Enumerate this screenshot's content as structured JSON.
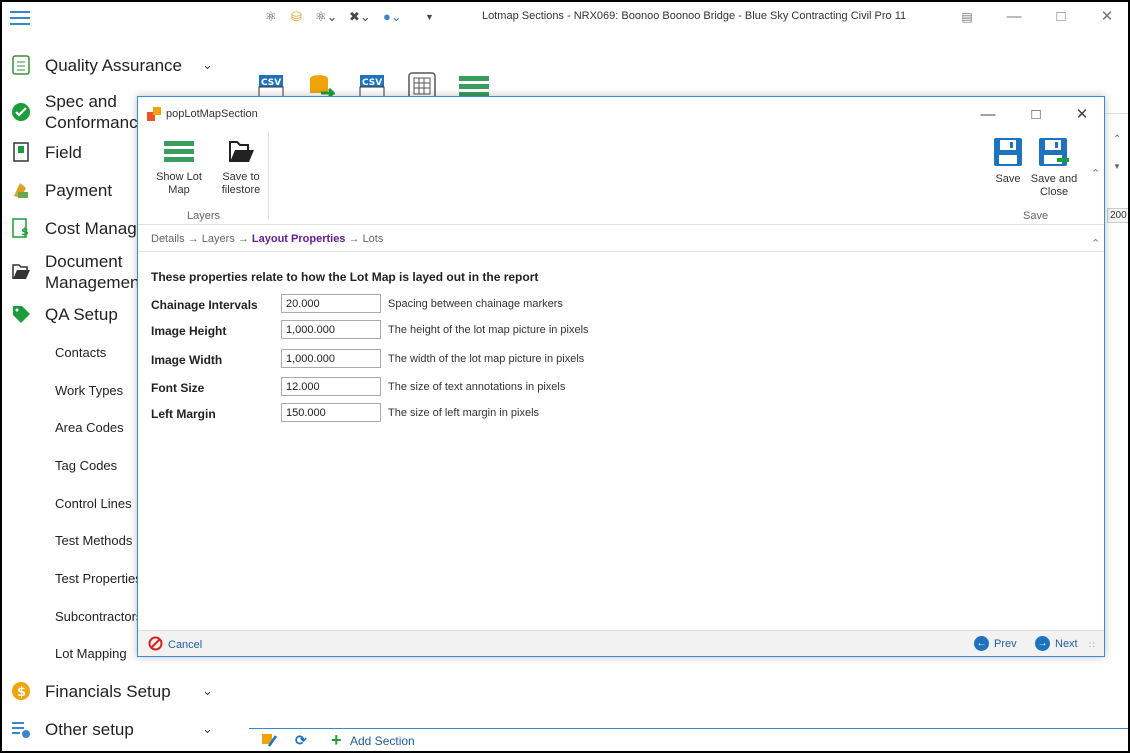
{
  "window": {
    "title": "Lotmap Sections - NRX069: Boonoo Boonoo Bridge  - Blue Sky Contracting Civil Pro 11"
  },
  "nav": {
    "items": [
      {
        "label": "Quality Assurance",
        "icon": "clipboard-icon"
      },
      {
        "label": "Spec and Conformance",
        "icon": "check-circle-icon"
      },
      {
        "label": "Field",
        "icon": "field-doc-icon"
      },
      {
        "label": "Payment",
        "icon": "payment-icon"
      },
      {
        "label": "Cost Management",
        "icon": "cost-icon"
      },
      {
        "label": "Document Management",
        "icon": "folder-open-icon"
      },
      {
        "label": "QA Setup",
        "icon": "tag-icon"
      },
      {
        "label": "Financials Setup",
        "icon": "dollar-coin-icon"
      },
      {
        "label": "Other setup",
        "icon": "settings-list-icon"
      }
    ],
    "sub_items": [
      "Contacts",
      "Work Types",
      "Area Codes",
      "Tag Codes",
      "Control Lines",
      "Test Methods",
      "Test Properties",
      "Subcontractors",
      "Lot Mapping"
    ]
  },
  "main": {
    "right_label": "200",
    "bottom_toolbar": {
      "add_label": "Add Section"
    }
  },
  "popup": {
    "title": "popLotMapSection",
    "ribbon": {
      "show_lot_map": "Show Lot Map",
      "save_to_filestore_line1": "Save to",
      "save_to_filestore_line2": "filestore",
      "group_layers": "Layers",
      "save": "Save",
      "save_and_close_line1": "Save and",
      "save_and_close_line2": "Close",
      "group_save": "Save"
    },
    "breadcrumb": {
      "details": "Details",
      "layers": "Layers",
      "layout_properties": "Layout Properties",
      "lots": "Lots",
      "arrow": "→"
    },
    "heading": "These properties relate to how the Lot Map is layed out in the report",
    "fields": [
      {
        "label": "Chainage Intervals",
        "value": "20.000",
        "description": "Spacing between chainage markers"
      },
      {
        "label": "Image Height",
        "value": "1,000.000",
        "description": "The height of the lot map picture in pixels"
      },
      {
        "label": "Image Width",
        "value": "1,000.000",
        "description": "The width of the lot map picture in pixels"
      },
      {
        "label": "Font Size",
        "value": "12.000",
        "description": "The size of text annotations in pixels"
      },
      {
        "label": "Left Margin",
        "value": "150.000",
        "description": "The size of left margin in pixels"
      }
    ],
    "footer": {
      "cancel": "Cancel",
      "prev": "Prev",
      "next": "Next"
    }
  },
  "colors": {
    "accent": "#1e73be",
    "breadcrumb_current": "#6a1b9a",
    "popup_border": "#3f8ad2"
  }
}
